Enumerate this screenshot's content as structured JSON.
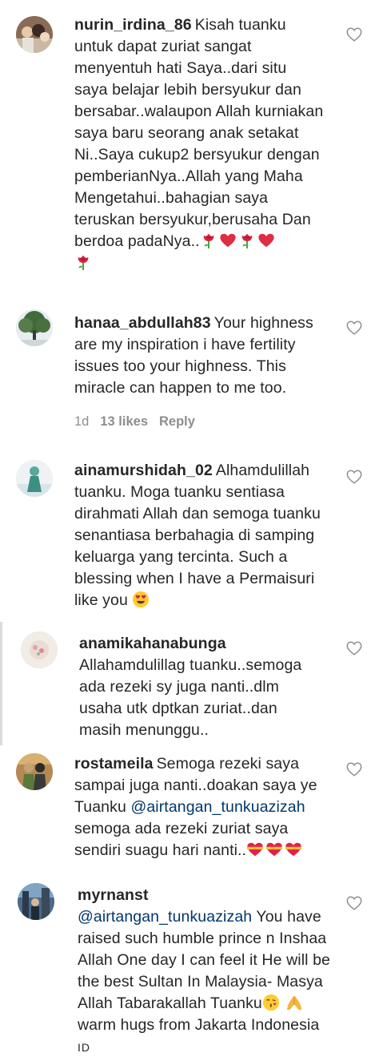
{
  "comments": [
    {
      "username": "nurin_irdina_86",
      "text": "Kisah tuanku untuk dapat zuriat sangat menyentuh hati Saya..dari situ saya belajar lebih bersyukur dan bersabar..walaupon Allah kurniakan saya baru seorang anak setakat Ni..Saya cukup2 bersyukur dengan pemberianNya..Allah yang Maha Mengetahui..bahagian saya teruskan bersyukur,berusaha Dan berdoa padaNya..",
      "emojis": [
        "rose",
        "red-heart",
        "rose",
        "red-heart",
        "rose"
      ]
    },
    {
      "username": "hanaa_abdullah83",
      "text": "Your highness are my inspiration i have fertility issues too your highness. This miracle can happen to me too.",
      "time": "1d",
      "likes": "13 likes",
      "reply": "Reply"
    },
    {
      "username": "ainamurshidah_02",
      "text": "Alhamdulillah tuanku. Moga tuanku sentiasa dirahmati Allah dan semoga tuanku senantiasa berbahagia di samping keluarga yang tercinta. Such a blessing when I have a Permaisuri like you",
      "emojis": [
        "heart-eyes"
      ]
    },
    {
      "username": "anamikahanabunga",
      "text": "Allahamdulillag tuanku..semoga ada rezeki sy juga nanti..dlm usaha utk dptkan zuriat..dan masih menunggu.."
    },
    {
      "username": "rostameila",
      "text_before": "Semoga rezeki saya sampai juga nanti..doakan saya ye Tuanku ",
      "mention": "@airtangan_tunkuazizah",
      "text_after": " semoga ada rezeki zuriat saya sendiri suagu hari nanti..",
      "emojis": [
        "heart-ribbon",
        "heart-ribbon",
        "heart-ribbon"
      ]
    },
    {
      "username": "myrnanst",
      "mention": "@airtangan_tunkuazizah",
      "text_part1": " You have raised such humble prince n Inshaa Allah One day I can feel it He will be the best Sultan In Malaysia- Masya Allah Tabarakallah Tuanku",
      "emojis": [
        "kissing-face",
        "folded-hands"
      ],
      "text_part2": " warm hugs from Jakarta Indonesia ",
      "flag": "ID"
    }
  ],
  "icons": {
    "like": "heart-outline-icon"
  },
  "colors": {
    "text": "#262626",
    "muted": "#8e8e8e",
    "mention": "#00376b",
    "heart": "#dd2e44"
  }
}
